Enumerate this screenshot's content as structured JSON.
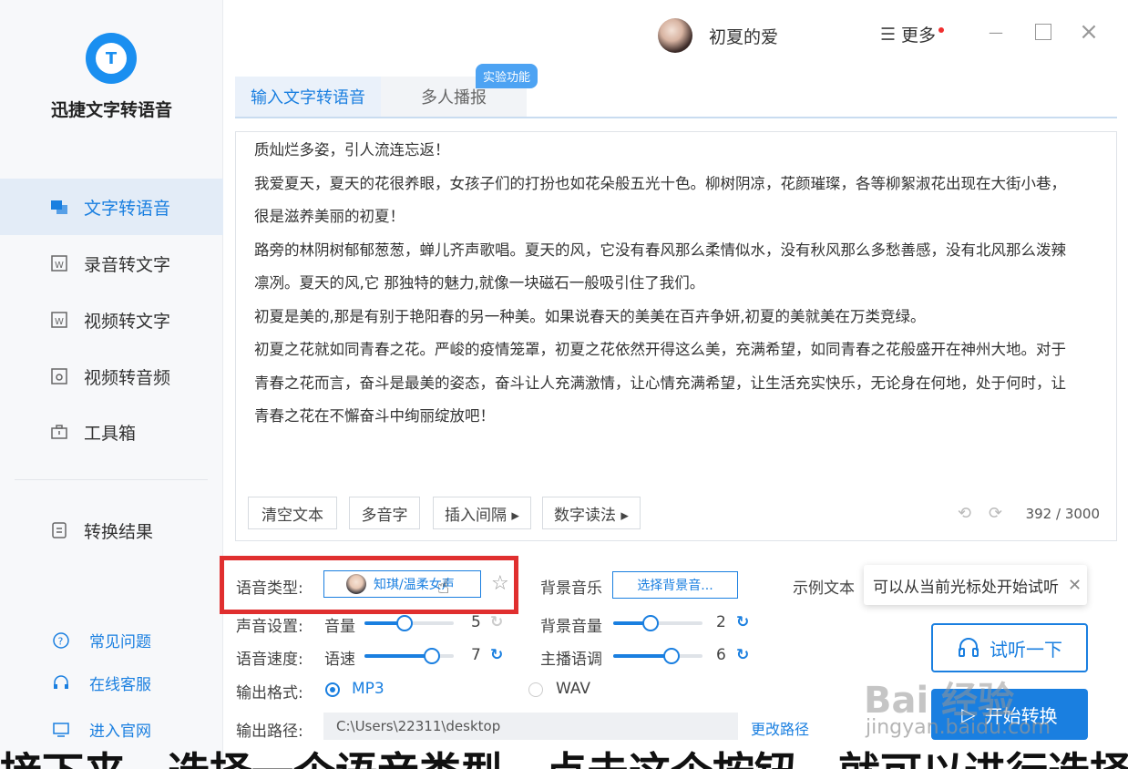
{
  "app": {
    "name": "迅捷文字转语音"
  },
  "sidebar": {
    "items": [
      {
        "label": "文字转语音",
        "icon": "text-to-speech-icon",
        "active": true
      },
      {
        "label": "录音转文字",
        "icon": "recording-to-text-icon"
      },
      {
        "label": "视频转文字",
        "icon": "video-to-text-icon"
      },
      {
        "label": "视频转音频",
        "icon": "video-to-audio-icon"
      },
      {
        "label": "工具箱",
        "icon": "toolbox-icon"
      },
      {
        "label": "转换结果",
        "icon": "results-icon"
      }
    ],
    "footer": [
      {
        "label": "常见问题",
        "icon": "question-icon"
      },
      {
        "label": "在线客服",
        "icon": "headset-icon"
      },
      {
        "label": "进入官网",
        "icon": "monitor-icon"
      }
    ]
  },
  "header": {
    "username": "初夏的爱",
    "more_label": "更多"
  },
  "tabs": [
    {
      "label": "输入文字转语音",
      "active": true
    },
    {
      "label": "多人播报",
      "badge": "实验功能"
    }
  ],
  "editor": {
    "lines": [
      "质灿烂多姿，引人流连忘返！",
      "我爱夏天，夏天的花很养眼，女孩子们的打扮也如花朵般五光十色。柳树阴凉，花颜璀璨，各等柳絮淑花出现在大街小巷，",
      "很是滋养美丽的初夏！",
      "路旁的林阴树郁郁葱葱，蝉儿齐声歌唱。夏天的风，它没有春风那么柔情似水，没有秋风那么多愁善感，没有北风那么泼辣",
      "凛冽。夏天的风,它 那独特的魅力,就像一块磁石一般吸引住了我们。",
      "初夏是美的,那是有别于艳阳春的另一种美。如果说春天的美美在百卉争妍,初夏的美就美在万类竞绿。",
      "初夏之花就如同青春之花。严峻的疫情笼罩，初夏之花依然开得这么美，充满希望，如同青春之花般盛开在神州大地。对于",
      "青春之花而言，奋斗是最美的姿态，奋斗让人充满激情，让心情充满希望，让生活充实快乐，无论身在何地，处于何时，让",
      "青春之花在不懈奋斗中绚丽绽放吧！"
    ],
    "toolbar": {
      "clear": "清空文本",
      "polyphone": "多音字",
      "insert_pause": "插入间隔 ▸",
      "number_read": "数字读法 ▸"
    },
    "counter": "392 / 3000"
  },
  "settings": {
    "voice_type_label": "语音类型:",
    "voice_name": "知琪/温柔女声",
    "bg_music_label": "背景音乐",
    "bg_music_button": "选择背景音...",
    "sample_label": "示例文本",
    "sample_text": "可以从当前光标处开始试听",
    "sound_label": "声音设置:",
    "volume_label": "音量",
    "volume_value": "5",
    "volume_fraction": 0.45,
    "bg_volume_label": "背景音量",
    "bg_volume_value": "2",
    "bg_volume_fraction": 0.42,
    "speed_row_label": "语音速度:",
    "speed_label": "语速",
    "speed_value": "7",
    "speed_fraction": 0.75,
    "pitch_label": "主播语调",
    "pitch_value": "6",
    "pitch_fraction": 0.65,
    "format_label": "输出格式:",
    "format_options": [
      "MP3",
      "WAV"
    ],
    "format_selected": "MP3",
    "path_label": "输出路径:",
    "path_value": "C:\\Users\\22311\\desktop",
    "change_path": "更改路径",
    "listen_button": "试听一下",
    "start_button": "开始转换"
  },
  "overlay": {
    "watermark": "Bai 经验",
    "watermark_url": "jingyan.baidu.com",
    "subtitle": "接下来，选择一个语音类型，点击这个按钮，就可以进行选择"
  },
  "colors": {
    "accent": "#1a7fe0",
    "highlight_box": "#e02f2f"
  }
}
